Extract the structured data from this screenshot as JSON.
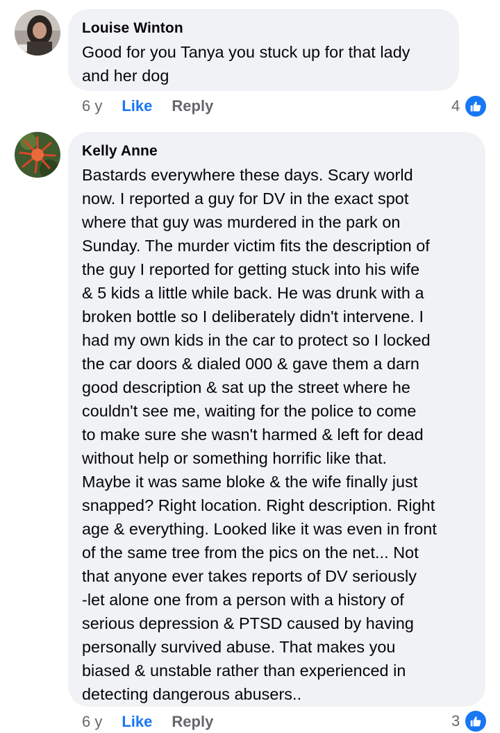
{
  "colors": {
    "accent": "#1877f2",
    "bubble": "#f0f2f5",
    "muted": "#65676b"
  },
  "comments": [
    {
      "author": "Louise Winton",
      "text": "Good for you Tanya you stuck up for that lady\nand her dog",
      "time": "6 y",
      "like_label": "Like",
      "reply_label": "Reply",
      "reaction_count": "4",
      "reaction_icon": "thumbs-up-icon"
    },
    {
      "author": "Kelly Anne",
      "text": "Bastards everywhere these days. Scary world\nnow. I reported a guy for DV in the exact spot\nwhere that guy was murdered in the park on\nSunday. The murder victim fits the description of\nthe guy I reported for getting stuck into his wife\n& 5 kids a little while back.  He was drunk with a\nbroken bottle so I deliberately didn't intervene. I\nhad my own kids in the car to protect so I locked\nthe car doors & dialed 000 & gave them a darn\ngood description & sat up the street where he\ncouldn't see me, waiting for the police to come\nto make sure she wasn't harmed & left for dead\nwithout help or something horrific like that.\nMaybe it was same bloke & the wife finally just\nsnapped? Right location. Right description. Right\nage & everything. Looked like it was even in front\nof the same tree from the pics on the net... Not\nthat anyone ever takes reports of DV seriously\n-let alone one from a person with a history of\nserious depression & PTSD caused by having\npersonally survived abuse. That makes you\nbiased & unstable rather than experienced in\ndetecting dangerous abusers..",
      "time": "6 y",
      "like_label": "Like",
      "reply_label": "Reply",
      "reaction_count": "3",
      "reaction_icon": "thumbs-up-icon"
    }
  ]
}
